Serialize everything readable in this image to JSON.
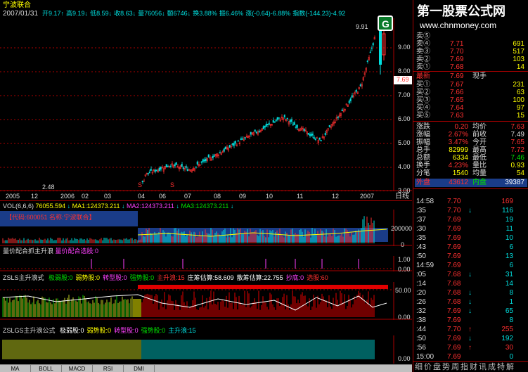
{
  "header": {
    "stock_name": "宁波联合",
    "date": "2007/01/31",
    "ohlc_line": [
      {
        "label": "开",
        "value": "9.17",
        "arrow": "↑",
        "color": "#00e0e0"
      },
      {
        "label": "高",
        "value": "9.19",
        "arrow": "↓",
        "color": "#00e0e0"
      },
      {
        "label": "低",
        "value": "8.59",
        "arrow": "↓",
        "color": "#00e0e0"
      },
      {
        "label": "收",
        "value": "8.63",
        "arrow": "↓",
        "color": "#00e0e0"
      },
      {
        "label": "量",
        "value": "76056",
        "arrow": "↓",
        "color": "#00e0e0"
      },
      {
        "label": "额",
        "value": "6746",
        "arrow": "↓",
        "color": "#00e0e0"
      },
      {
        "label": "换",
        "value": "3.88%",
        "arrow": "",
        "color": "#00e0e0"
      },
      {
        "label": "振",
        "value": "6.46%",
        "arrow": "",
        "color": "#00e0e0"
      },
      {
        "label": "涨",
        "value": "(-0.64)-6.88%",
        "arrow": "",
        "color": "#00e0e0"
      },
      {
        "label": "指数",
        "value": "(-144.23)-4.92",
        "arrow": "",
        "color": "#00e0e0"
      }
    ],
    "high_marker": "9.91",
    "low_marker": "2.48"
  },
  "watermark": {
    "title": "第一股票公式网",
    "url": "www.chnmoney.com",
    "logo_letter": "G"
  },
  "price_axis": [
    "9.00",
    "8.00",
    "7.00",
    "6.00",
    "5.00",
    "4.00",
    "3.00"
  ],
  "current_price_tag": "7.69",
  "date_axis": [
    "2005",
    "12",
    "2006",
    "02",
    "03",
    "04",
    "06",
    "07",
    "08",
    "09",
    "10",
    "11",
    "12",
    "2007"
  ],
  "date_axis_unit": "日线",
  "split_markers": [
    "S",
    "S"
  ],
  "volume": {
    "title": "VOL(6,6,6)",
    "value": "76055.594",
    "ma1": "MA1:124373.211",
    "ma2": "MA2:124373.211",
    "ma3": "MA3:124373.211",
    "code_label": "【代码:600051  名称:宁波联合】",
    "axis": [
      "200000",
      "0"
    ]
  },
  "panel2": {
    "title": "量价配合抓主升浪",
    "subtitle": "量价配合选股:0",
    "axis": [
      "1.00",
      "0.00"
    ]
  },
  "panel3": {
    "title": "ZSLS主升浪式",
    "items": [
      {
        "text": "极弱股:0",
        "color": "#00e000"
      },
      {
        "text": "弱势股:0",
        "color": "#ffff00"
      },
      {
        "text": "转型股:0",
        "color": "#ff40ff"
      },
      {
        "text": "强势股:0",
        "color": "#00e000"
      },
      {
        "text": "主升浪:15",
        "color": "#ff3030"
      },
      {
        "text": "庄筹估算:58.609",
        "color": "#ffffff"
      },
      {
        "text": "散筹估算:22.755",
        "color": "#ffffff"
      },
      {
        "text": "抄底:0",
        "color": "#ff40ff"
      },
      {
        "text": "选股:60",
        "color": "#ff3030"
      }
    ],
    "axis": [
      "50.00",
      "0.00"
    ]
  },
  "panel4": {
    "title": "ZSLGS主升浪公式",
    "items": [
      {
        "text": "极弱股:0",
        "color": "#ffffff"
      },
      {
        "text": "弱势股:0",
        "color": "#ffff00"
      },
      {
        "text": "转型股:0",
        "color": "#ff40ff"
      },
      {
        "text": "强势股:0",
        "color": "#00e000"
      },
      {
        "text": "主升浪:15",
        "color": "#00e0e0"
      }
    ],
    "axis": [
      "0.00"
    ]
  },
  "bottom_tabs": [
    "MA",
    "BOLL",
    "MACD",
    "RSI",
    "DMI"
  ],
  "quote": {
    "sell": [
      {
        "label": "卖⑤",
        "price": "",
        "vol": ""
      },
      {
        "label": "卖④",
        "price": "7.71",
        "vol": "691"
      },
      {
        "label": "卖③",
        "price": "7.70",
        "vol": "517"
      },
      {
        "label": "卖②",
        "price": "7.69",
        "vol": "103"
      },
      {
        "label": "卖①",
        "price": "7.68",
        "vol": "14"
      }
    ],
    "latest": {
      "label": "最新",
      "price": "7.69",
      "extra": "现手"
    },
    "buy": [
      {
        "label": "买①",
        "price": "7.67",
        "vol": "231"
      },
      {
        "label": "买②",
        "price": "7.66",
        "vol": "63"
      },
      {
        "label": "买③",
        "price": "7.65",
        "vol": "100"
      },
      {
        "label": "买④",
        "price": "7.64",
        "vol": "97"
      },
      {
        "label": "买⑤",
        "price": "7.63",
        "vol": "15"
      }
    ],
    "stats": [
      {
        "l1": "涨跌",
        "v1": "0.20",
        "c1": "#ff3030",
        "l2": "均价",
        "v2": "7.63",
        "c2": "#ff3030"
      },
      {
        "l1": "涨幅",
        "v1": "2.67%",
        "c1": "#ff3030",
        "l2": "前收",
        "v2": "7.49",
        "c2": "#dddddd"
      },
      {
        "l1": "振幅",
        "v1": "3.47%",
        "c1": "#ff3030",
        "l2": "今开",
        "v2": "7.65",
        "c2": "#ff3030"
      },
      {
        "l1": "总手",
        "v1": "82999",
        "c1": "#ffff00",
        "l2": "最高",
        "v2": "7.72",
        "c2": "#ff3030"
      },
      {
        "l1": "总额",
        "v1": "6334",
        "c1": "#ffff00",
        "l2": "最低",
        "v2": "7.46",
        "c2": "#00e000"
      },
      {
        "l1": "换手",
        "v1": "4.23%",
        "c1": "#ff3030",
        "l2": "量比",
        "v2": "0.93",
        "c2": "#ffff00"
      },
      {
        "l1": "分笔",
        "v1": "1540",
        "c1": "#ffff00",
        "l2": "均量",
        "v2": "54",
        "c2": "#ffff00"
      }
    ],
    "outer": {
      "label": "外盘",
      "value": "43612",
      "inner_label": "内盘",
      "inner_value": "39387"
    }
  },
  "ticks": [
    {
      "time": "14:58",
      "price": "7.70",
      "arrow": "",
      "vol": "169",
      "pcolor": "#ff3030",
      "vcolor": "#ff3030"
    },
    {
      "time": ":35",
      "price": "7.70",
      "arrow": "↓",
      "vol": "116",
      "pcolor": "#ff3030",
      "vcolor": "#00e0e0"
    },
    {
      "time": ":37",
      "price": "7.69",
      "arrow": "",
      "vol": "19",
      "pcolor": "#ff3030",
      "vcolor": "#00e0e0"
    },
    {
      "time": ":30",
      "price": "7.69",
      "arrow": "",
      "vol": "11",
      "pcolor": "#ff3030",
      "vcolor": "#00e0e0"
    },
    {
      "time": ":35",
      "price": "7.69",
      "arrow": "",
      "vol": "10",
      "pcolor": "#ff3030",
      "vcolor": "#00e0e0"
    },
    {
      "time": ":43",
      "price": "7.69",
      "arrow": "",
      "vol": "6",
      "pcolor": "#ff3030",
      "vcolor": "#00e0e0"
    },
    {
      "time": ":50",
      "price": "7.69",
      "arrow": "",
      "vol": "13",
      "pcolor": "#ff3030",
      "vcolor": "#00e0e0"
    },
    {
      "time": "14:59",
      "price": "7.69",
      "arrow": "",
      "vol": "6",
      "pcolor": "#ff3030",
      "vcolor": "#00e0e0"
    },
    {
      "time": ":05",
      "price": "7.68",
      "arrow": "↓",
      "vol": "31",
      "pcolor": "#ff3030",
      "vcolor": "#00e0e0"
    },
    {
      "time": ":14",
      "price": "7.68",
      "arrow": "",
      "vol": "14",
      "pcolor": "#ff3030",
      "vcolor": "#00e0e0"
    },
    {
      "time": ":20",
      "price": "7.68",
      "arrow": "↓",
      "vol": "8",
      "pcolor": "#ff3030",
      "vcolor": "#00e0e0"
    },
    {
      "time": ":26",
      "price": "7.68",
      "arrow": "↓",
      "vol": "1",
      "pcolor": "#ff3030",
      "vcolor": "#00e0e0"
    },
    {
      "time": ":32",
      "price": "7.69",
      "arrow": "↓",
      "vol": "65",
      "pcolor": "#ff3030",
      "vcolor": "#00e0e0"
    },
    {
      "time": ":38",
      "price": "7.69",
      "arrow": "",
      "vol": "8",
      "pcolor": "#ff3030",
      "vcolor": "#00e0e0"
    },
    {
      "time": ":44",
      "price": "7.70",
      "arrow": "↑",
      "vol": "255",
      "pcolor": "#ff3030",
      "vcolor": "#ff3030"
    },
    {
      "time": ":50",
      "price": "7.69",
      "arrow": "↓",
      "vol": "192",
      "pcolor": "#ff3030",
      "vcolor": "#00e0e0"
    },
    {
      "time": ":56",
      "price": "7.69",
      "arrow": "↑",
      "vol": "30",
      "pcolor": "#ff3030",
      "vcolor": "#ff3030"
    },
    {
      "time": "15:00",
      "price": "7.69",
      "arrow": "",
      "vol": "0",
      "pcolor": "#ff3030",
      "vcolor": "#00e0e0"
    }
  ],
  "right_tabs": "细价盘势周指财讯成特解"
}
